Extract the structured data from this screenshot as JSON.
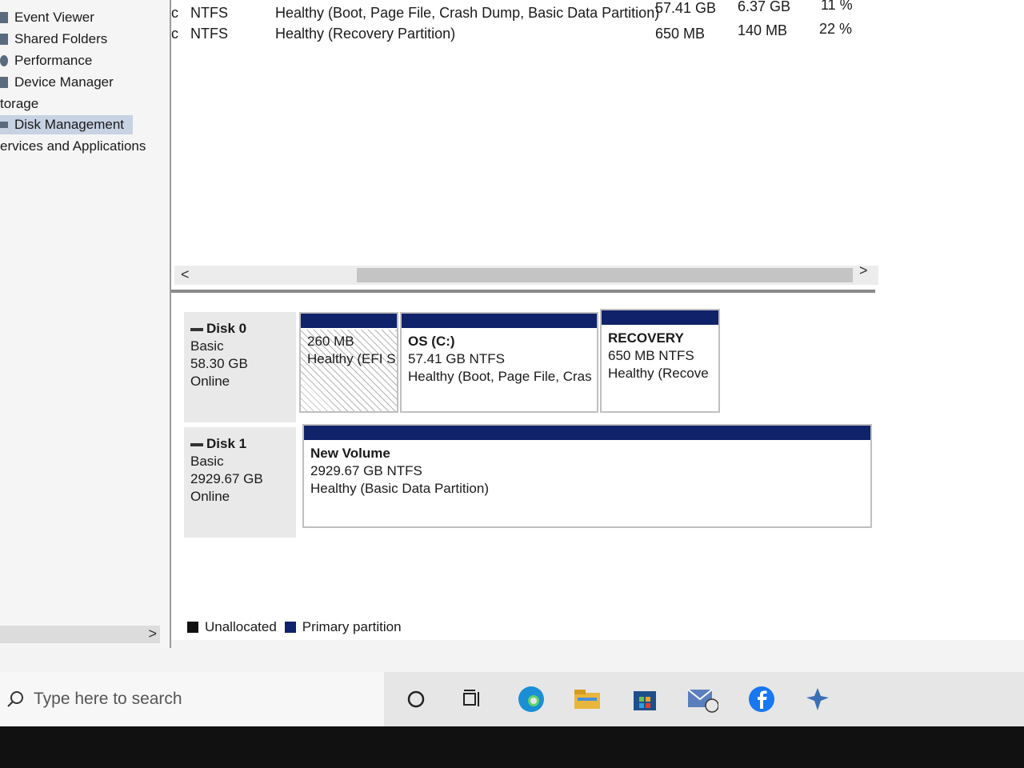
{
  "tree": {
    "items": [
      {
        "label": "Event Viewer",
        "selected": false
      },
      {
        "label": "Shared Folders",
        "selected": false
      },
      {
        "label": "Performance",
        "selected": false
      },
      {
        "label": "Device Manager",
        "selected": false
      },
      {
        "label": "torage",
        "selected": false
      },
      {
        "label": "Disk Management",
        "selected": true
      },
      {
        "label": "ervices and Applications",
        "selected": false
      }
    ],
    "scroll_arrow": ">"
  },
  "volumes": {
    "rows": [
      {
        "type": "c",
        "fs": "NTFS",
        "status": "Healthy (Boot, Page File, Crash Dump, Basic Data Partition)",
        "capacity": "57.41 GB",
        "free": "6.37 GB",
        "pct": "11 %"
      },
      {
        "type": "c",
        "fs": "NTFS",
        "status": "Healthy (Recovery Partition)",
        "capacity": "650 MB",
        "free": "140 MB",
        "pct": "22 %"
      }
    ],
    "scroll_left": "<",
    "scroll_right": ">"
  },
  "disks": [
    {
      "name": "Disk 0",
      "type": "Basic",
      "size": "58.30 GB",
      "status": "Online",
      "partitions": [
        {
          "title": "",
          "size": "260 MB",
          "status": "Healthy (EFI S"
        },
        {
          "title": "OS  (C:)",
          "size": "57.41 GB NTFS",
          "status": "Healthy (Boot, Page File, Cras"
        },
        {
          "title": "RECOVERY",
          "size": "650 MB NTFS",
          "status": "Healthy (Recove"
        }
      ]
    },
    {
      "name": "Disk 1",
      "type": "Basic",
      "size": "2929.67 GB",
      "status": "Online",
      "partitions": [
        {
          "title": "New Volume",
          "size": "2929.67 GB NTFS",
          "status": "Healthy (Basic Data Partition)"
        }
      ]
    }
  ],
  "legend": {
    "unallocated": "Unallocated",
    "primary": "Primary partition",
    "unallocated_color": "#111111",
    "primary_color": "#10226a"
  },
  "taskbar": {
    "search_placeholder": "Type here to search",
    "icons": [
      "cortana-circle-icon",
      "task-view-icon",
      "edge-icon",
      "file-explorer-icon",
      "store-icon",
      "mail-icon",
      "facebook-icon",
      "pinned-app-icon"
    ]
  }
}
